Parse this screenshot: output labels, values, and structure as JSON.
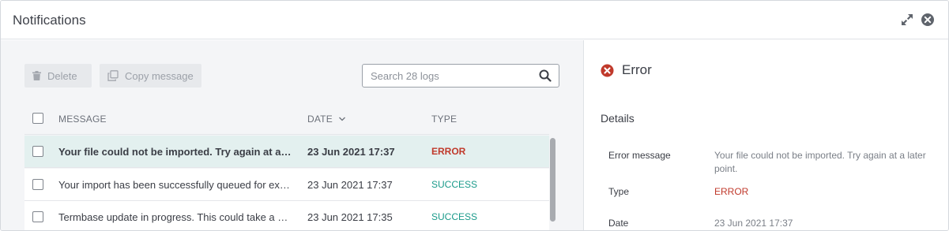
{
  "window": {
    "title": "Notifications",
    "expand_icon": "expand-icon",
    "close_icon": "close-circle-icon"
  },
  "toolbar": {
    "delete_label": "Delete",
    "copy_label": "Copy message",
    "search_placeholder": "Search 28 logs"
  },
  "table": {
    "columns": {
      "message": "MESSAGE",
      "date": "DATE",
      "type": "TYPE"
    },
    "rows": [
      {
        "message": "Your file could not be imported. Try again at a later point.",
        "date": "23 Jun 2021 17:37",
        "type": "ERROR",
        "selected": true
      },
      {
        "message": "Your import has been successfully queued for execution.",
        "date": "23 Jun 2021 17:37",
        "type": "SUCCESS",
        "selected": false
      },
      {
        "message": "Termbase update in progress. This could take a while.",
        "date": "23 Jun 2021 17:35",
        "type": "SUCCESS",
        "selected": false
      }
    ]
  },
  "detail": {
    "title": "Error",
    "details_heading": "Details",
    "error_message_label": "Error message",
    "error_message_value": "Your file could not be imported. Try again at a later point.",
    "type_label": "Type",
    "type_value": "ERROR",
    "date_label": "Date",
    "date_value": "23 Jun 2021 17:37"
  },
  "colors": {
    "error": "#c0392b",
    "success": "#1a9a8a",
    "selected_row": "#e3f0ef"
  }
}
